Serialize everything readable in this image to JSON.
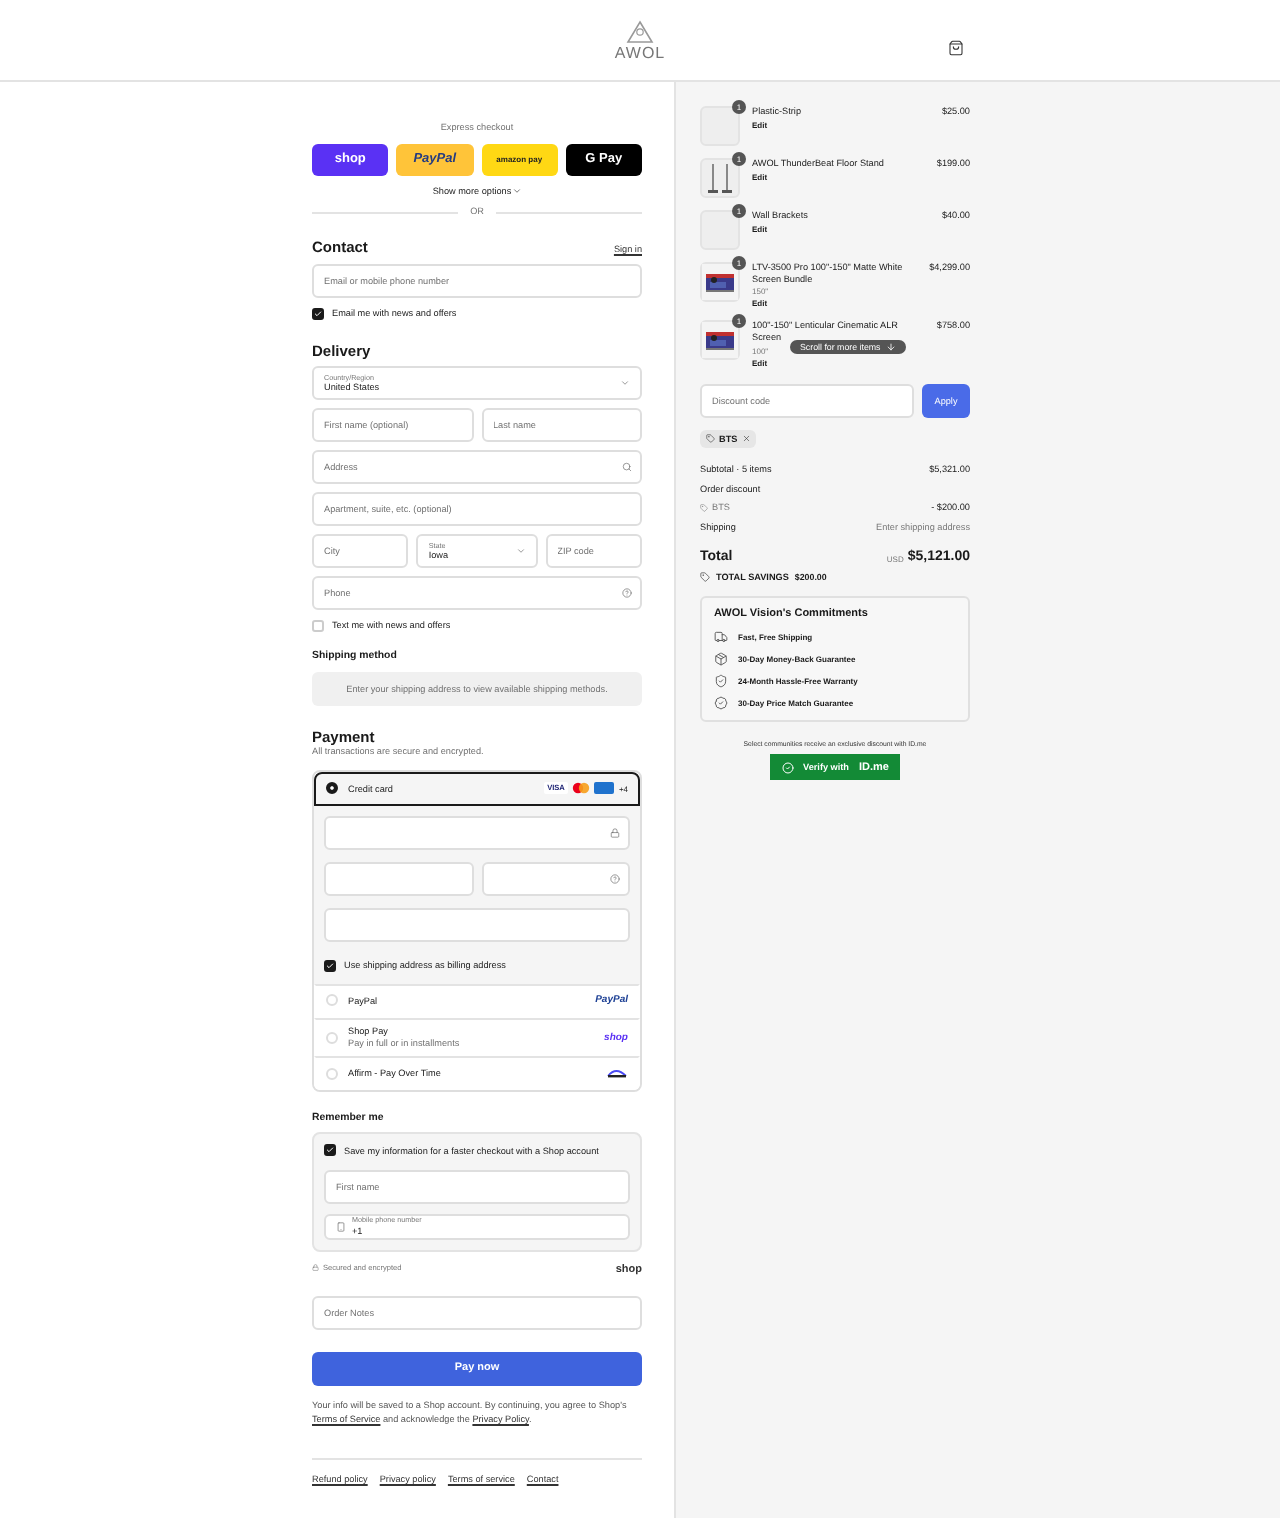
{
  "header": {
    "logo": "AWOL"
  },
  "express": {
    "title": "Express checkout",
    "buttons": [
      {
        "kind": "shop",
        "label": "shop"
      },
      {
        "kind": "paypal",
        "label": "PayPal"
      },
      {
        "kind": "amazon",
        "label": "amazon pay"
      },
      {
        "kind": "gpay",
        "label": "G Pay"
      }
    ],
    "more": "Show more options",
    "or": "OR"
  },
  "contact": {
    "heading": "Contact",
    "sign_in": "Sign in",
    "email_placeholder": "Email or mobile phone number",
    "news": {
      "label": "Email me with news and offers",
      "checked": true
    }
  },
  "delivery": {
    "heading": "Delivery",
    "rows": [
      [
        {
          "kind": "select",
          "label": "Country/Region",
          "value": "United States"
        }
      ],
      [
        {
          "kind": "text",
          "placeholder": "First name (optional)"
        },
        {
          "kind": "text",
          "placeholder": "Last name"
        }
      ],
      [
        {
          "kind": "search",
          "placeholder": "Address"
        }
      ],
      [
        {
          "kind": "text",
          "placeholder": "Apartment, suite, etc. (optional)"
        }
      ],
      [
        {
          "kind": "text",
          "placeholder": "City"
        },
        {
          "kind": "select",
          "label": "State",
          "value": "Iowa"
        },
        {
          "kind": "text",
          "placeholder": "ZIP code"
        }
      ],
      [
        {
          "kind": "help",
          "placeholder": "Phone"
        }
      ]
    ],
    "text_me": {
      "label": "Text me with news and offers",
      "checked": false
    }
  },
  "shipping_method": {
    "heading": "Shipping method",
    "message": "Enter your shipping address to view available shipping methods."
  },
  "payment": {
    "heading": "Payment",
    "subtitle": "All transactions are secure and encrypted.",
    "methods": [
      {
        "kind": "card",
        "label": "Credit card",
        "selected": true,
        "visa": "VISA",
        "more": "+4",
        "billing": {
          "label": "Use shipping address as billing address",
          "checked": true
        }
      },
      {
        "kind": "paypal",
        "label": "PayPal",
        "selected": false,
        "logo": "PayPal"
      },
      {
        "kind": "shoppay",
        "label": "Shop Pay",
        "sub": "Pay in full or in installments",
        "selected": false,
        "logo": "shop"
      },
      {
        "kind": "affirm",
        "label": "Affirm - Pay Over Time",
        "selected": false
      }
    ]
  },
  "remember": {
    "heading": "Remember me",
    "save": {
      "label": "Save my information for a faster checkout with a Shop account",
      "checked": true
    },
    "first_name": {
      "placeholder": "First name"
    },
    "phone_label": "Mobile phone number",
    "phone_value": "+1",
    "secure": "Secured and encrypted",
    "shop_logo": "shop"
  },
  "order_notes": {
    "placeholder": "Order Notes"
  },
  "pay_button": "Pay now",
  "legal": [
    {
      "kind": "text",
      "text": "Your info will be saved to a Shop account. By continuing, you agree to Shop's "
    },
    {
      "kind": "link",
      "text": "Terms of Service"
    },
    {
      "kind": "text",
      "text": " and acknowledge the "
    },
    {
      "kind": "link",
      "text": "Privacy Policy"
    },
    {
      "kind": "text",
      "text": "."
    }
  ],
  "footer_links": [
    "Refund policy",
    "Privacy policy",
    "Terms of service",
    "Contact"
  ],
  "cart": {
    "items": [
      {
        "kind": "blank",
        "qty": "1",
        "name": "Plastic-Strip",
        "price": "$25.00",
        "edit": "Edit"
      },
      {
        "kind": "stand",
        "qty": "1",
        "name": "AWOL ThunderBeat Floor Stand",
        "price": "$199.00",
        "edit": "Edit"
      },
      {
        "kind": "blank",
        "qty": "1",
        "name": "Wall Brackets",
        "price": "$40.00",
        "edit": "Edit"
      },
      {
        "kind": "picture",
        "qty": "1",
        "name": "LTV-3500 Pro 100\"-150\" Matte White Screen Bundle",
        "variant": "150\"",
        "price": "$4,299.00",
        "edit": "Edit"
      },
      {
        "kind": "picture",
        "qty": "1",
        "name": "100\"-150\" Lenticular Cinematic ALR Screen",
        "variant": "100\"",
        "price": "$758.00",
        "edit": "Edit"
      }
    ],
    "scroll_hint": "Scroll for more items",
    "discount_placeholder": "Discount code",
    "apply": "Apply",
    "tag": "BTS",
    "summary": [
      {
        "kind": "plain",
        "label": "Subtotal · 5 items",
        "value": "$5,321.00"
      },
      {
        "kind": "heading",
        "label": "Order discount"
      },
      {
        "kind": "code",
        "label": "BTS",
        "value": "- $200.00"
      },
      {
        "kind": "muted",
        "label": "Shipping",
        "value": "Enter shipping address"
      }
    ],
    "total_label": "Total",
    "currency": "USD",
    "total": "$5,121.00",
    "savings_label": "TOTAL SAVINGS",
    "savings": "$200.00",
    "commitments": {
      "title": "AWOL Vision's Commitments",
      "items": [
        {
          "kind": "truck",
          "label": "Fast, Free Shipping"
        },
        {
          "kind": "box",
          "label": "30-Day Money-Back Guarantee"
        },
        {
          "kind": "shield",
          "label": "24-Month Hassle-Free Warranty"
        },
        {
          "kind": "badge",
          "label": "30-Day Price Match Guarantee"
        }
      ]
    },
    "verify_note": "Select communities receive an exclusive discount with ID.me",
    "verify": "Verify with",
    "verify_logo": "ID.me"
  }
}
